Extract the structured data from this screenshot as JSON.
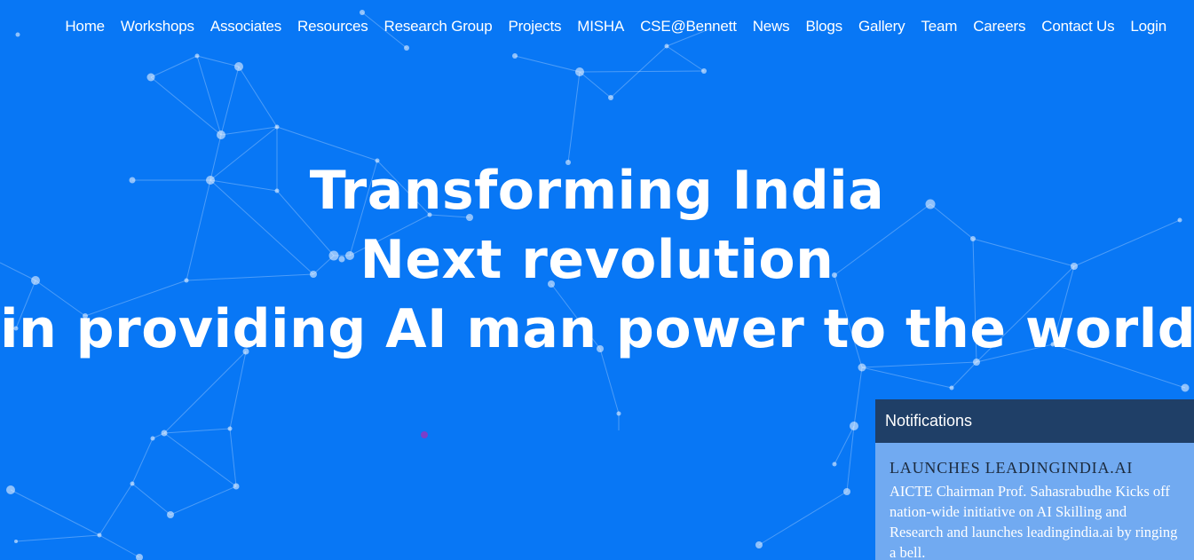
{
  "nav": {
    "items": [
      {
        "label": "Home"
      },
      {
        "label": "Workshops"
      },
      {
        "label": "Associates"
      },
      {
        "label": "Resources"
      },
      {
        "label": "Research Group"
      },
      {
        "label": "Projects"
      },
      {
        "label": "MISHA"
      },
      {
        "label": "CSE@Bennett"
      },
      {
        "label": "News"
      },
      {
        "label": "Blogs"
      },
      {
        "label": "Gallery"
      },
      {
        "label": "Team"
      },
      {
        "label": "Careers"
      },
      {
        "label": "Contact Us"
      },
      {
        "label": "Login"
      }
    ]
  },
  "hero": {
    "line1": "Transforming India",
    "line2": "Next revolution",
    "line3": "in providing AI man power to the world"
  },
  "notifications": {
    "header": "Notifications",
    "item_title": "LAUNCHES LEADINGINDIA.AI",
    "item_text": "AICTE Chairman Prof. Sahasrabudhe Kicks off nation-wide initiative on AI Skilling and Research and launches leadingindia.ai by ringing a bell."
  },
  "colors": {
    "background": "#0877f5",
    "notif_header": "#1f3f67",
    "notif_body": "#89b6f0",
    "text": "#ffffff"
  },
  "icons": {
    "background": "network-constellation-icon"
  }
}
